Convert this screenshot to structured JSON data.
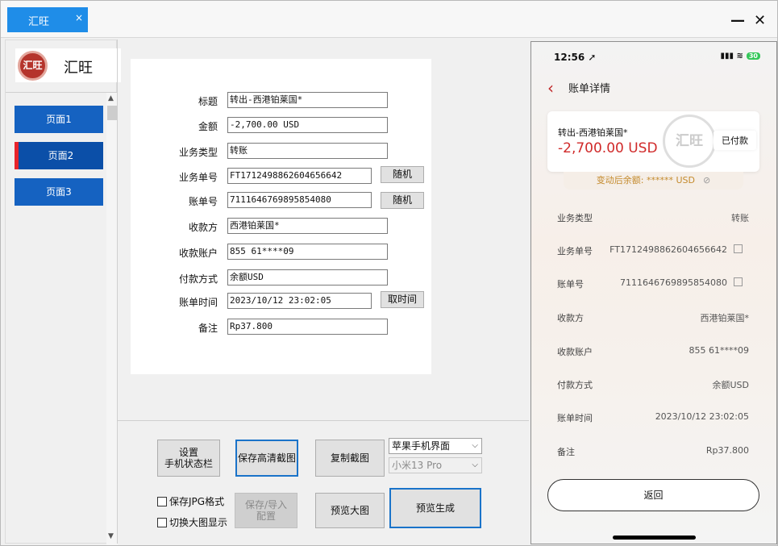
{
  "window": {
    "tab_title": "汇旺",
    "tab_close": "×",
    "minimize": "—",
    "close": "✕"
  },
  "sidebar": {
    "logo_emblem": "汇旺",
    "logo_text": "汇旺",
    "items": [
      {
        "label": "页面1"
      },
      {
        "label": "页面2"
      },
      {
        "label": "页面3"
      }
    ]
  },
  "form": {
    "fields": [
      {
        "label": "标题",
        "value": "转出-西港铂莱国*"
      },
      {
        "label": "金额",
        "value": "-2,700.00 USD"
      },
      {
        "label": "业务类型",
        "value": "转账"
      },
      {
        "label": "业务单号",
        "value": "FT1712498862604656642"
      },
      {
        "label": "账单号",
        "value": "7111646769895854080"
      },
      {
        "label": "收款方",
        "value": "西港铂莱国*"
      },
      {
        "label": "收款账户",
        "value": "855 61****09"
      },
      {
        "label": "付款方式",
        "value": "余额USD"
      },
      {
        "label": "账单时间",
        "value": "2023/10/12 23:02:05"
      },
      {
        "label": "备注",
        "value": "Rp37.800"
      }
    ],
    "random_btn_1": "随机",
    "random_btn_2": "随机",
    "get_time_btn": "取时间"
  },
  "toolbar": {
    "set_statusbar": "设置\n手机状态栏",
    "save_hd": "保存高清截图",
    "copy_shot": "复制截图",
    "device_select": "苹果手机界面",
    "model_select": "小米13 Pro",
    "save_jpg": "保存JPG格式",
    "toggle_large": "切换大图显示",
    "save_import": "保存/导入\n配置",
    "preview_large": "预览大图",
    "preview_generate": "预览生成"
  },
  "phone": {
    "time": "12:56",
    "battery": "30",
    "page_title": "账单详情",
    "card_name": "转出-西港铂莱国*",
    "card_amount": "-2,700.00 USD",
    "stamp": "汇旺",
    "paid_badge": "已付款",
    "balance_text": "变动后余额: ****** USD",
    "rows": [
      {
        "label": "业务类型",
        "value": "转账"
      },
      {
        "label": "业务单号",
        "value": "FT1712498862604656642"
      },
      {
        "label": "账单号",
        "value": "7111646769895854080"
      },
      {
        "label": "收款方",
        "value": "西港铂莱国*"
      },
      {
        "label": "收款账户",
        "value": "855 61****09"
      },
      {
        "label": "付款方式",
        "value": "余额USD"
      },
      {
        "label": "账单时间",
        "value": "2023/10/12 23:02:05"
      },
      {
        "label": "备注",
        "value": "Rp37.800"
      }
    ],
    "return_btn": "返回"
  }
}
